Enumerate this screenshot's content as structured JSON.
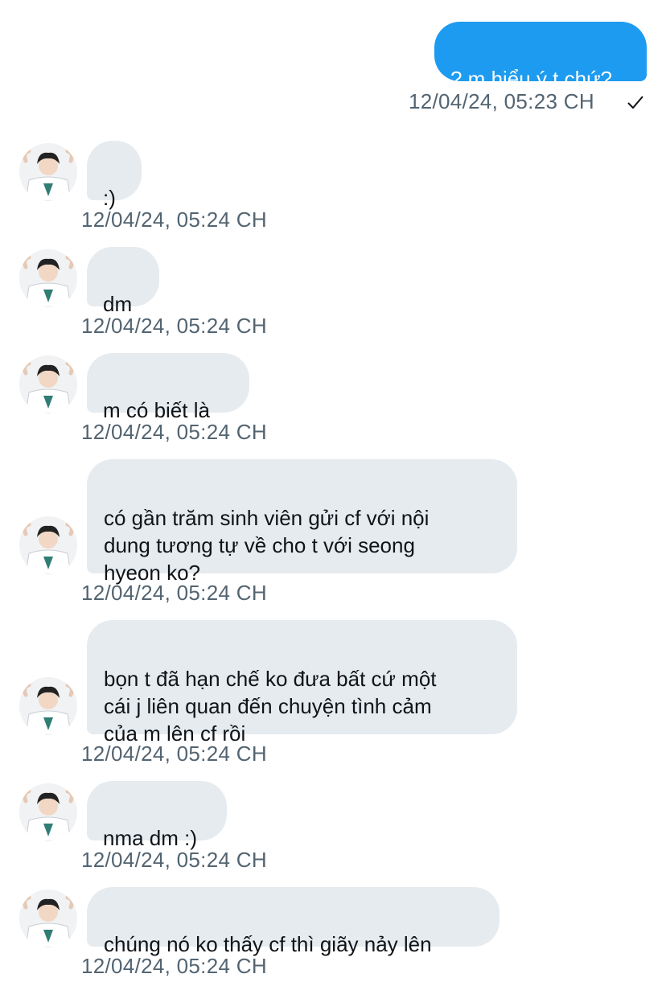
{
  "conversation": {
    "outgoing": [
      {
        "text": "? m hiểu ý t chứ?",
        "timestamp": "12/04/24, 05:23 CH",
        "status_icon": "checkmark-icon"
      }
    ],
    "incoming": [
      {
        "text": ":)",
        "timestamp": "12/04/24, 05:24 CH"
      },
      {
        "text": "dm",
        "timestamp": "12/04/24, 05:24 CH"
      },
      {
        "text": "m có biết là",
        "timestamp": "12/04/24, 05:24 CH"
      },
      {
        "text": "có gần trăm sinh viên gửi cf với nội\ndung tương tự về cho t với seong\nhyeon ko?",
        "timestamp": "12/04/24, 05:24 CH"
      },
      {
        "text": "bọn t đã hạn chế ko đưa bất cứ một\ncái j liên quan đến chuyện tình cảm\ncủa m lên cf rồi",
        "timestamp": "12/04/24, 05:24 CH"
      },
      {
        "text": "nma dm :)",
        "timestamp": "12/04/24, 05:24 CH"
      },
      {
        "text": "chúng nó ko thấy cf thì giãy nảy lên",
        "timestamp": "12/04/24, 05:24 CH"
      }
    ]
  },
  "colors": {
    "sent_bubble": "#1d9bf0",
    "received_bubble": "#e6ebef",
    "timestamp_text": "#536471",
    "message_text": "#0f1419"
  },
  "icons": {
    "avatar": "user-avatar",
    "read_status": "checkmark-icon"
  }
}
